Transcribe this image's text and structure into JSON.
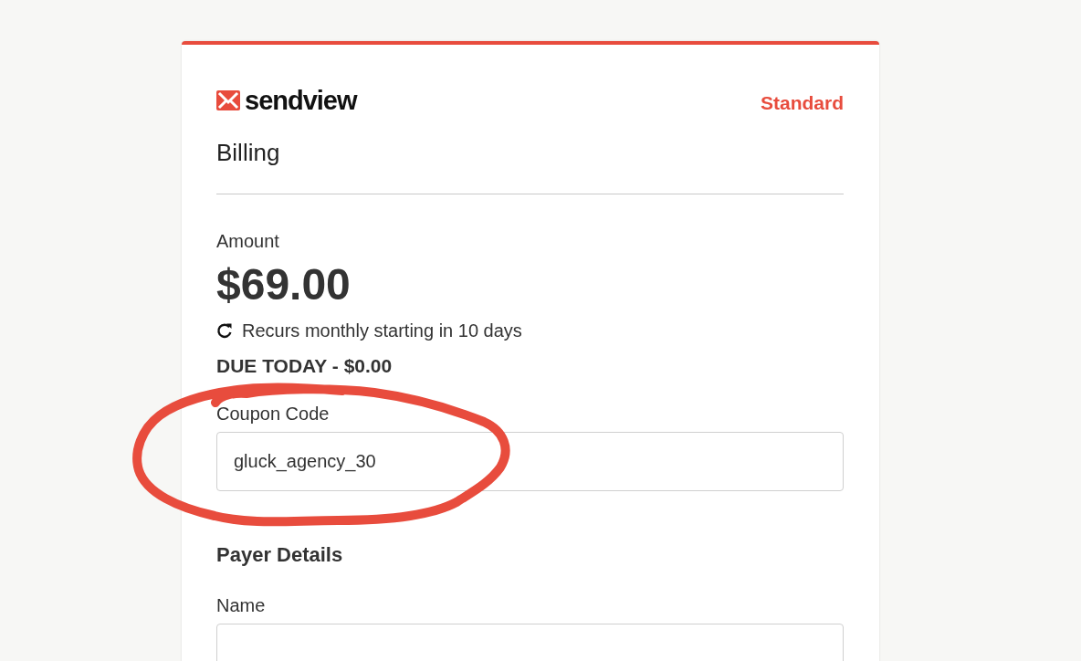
{
  "header": {
    "logo_text": "sendview",
    "plan": "Standard"
  },
  "title": "Billing",
  "amount": {
    "label": "Amount",
    "value": "$69.00",
    "recurrence": "Recurs monthly starting in 10 days",
    "due_today": "DUE TODAY - $0.00"
  },
  "coupon": {
    "label": "Coupon Code",
    "value": "gluck_agency_30"
  },
  "payer_details": {
    "heading": "Payer Details",
    "fields": [
      {
        "label": "Name"
      }
    ]
  }
}
